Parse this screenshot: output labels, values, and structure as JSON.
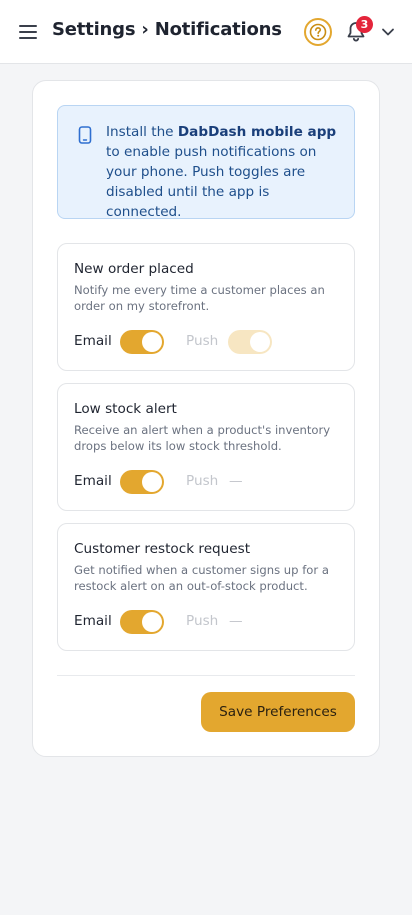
{
  "header": {
    "title": "Settings › Notifications",
    "notification_count": "3",
    "icons": {
      "menu": "hamburger-menu-icon",
      "help": "help-circle-icon",
      "bell": "bell-icon",
      "account_menu": "chevron-down-icon"
    }
  },
  "info_banner": {
    "icon": "mobile-phone-icon",
    "text_before": "Install the ",
    "app_name": "DabDash mobile app",
    "text_after": " to enable push notifications on your phone. Push toggles are disabled until the app is connected."
  },
  "notifications": [
    {
      "title": "New order placed",
      "description": "Notify me every time a customer places an order on my storefront.",
      "email_label": "Email",
      "email_enabled": true,
      "push_label": "Push",
      "push_state": "on-disabled"
    },
    {
      "title": "Low stock alert",
      "description": "Receive an alert when a product's inventory drops below its low stock threshold.",
      "email_label": "Email",
      "email_enabled": true,
      "push_label": "Push",
      "push_value": "—"
    },
    {
      "title": "Customer restock request",
      "description": "Get notified when a customer signs up for a restock alert on an out-of-stock product.",
      "email_label": "Email",
      "email_enabled": true,
      "push_label": "Push",
      "push_value": "—"
    }
  ],
  "actions": {
    "save_label": "Save Preferences"
  },
  "colors": {
    "accent": "#e3a72f",
    "badge": "#e4253b",
    "info_bg": "#e8f2fd",
    "info_text": "#1f4f8b"
  }
}
